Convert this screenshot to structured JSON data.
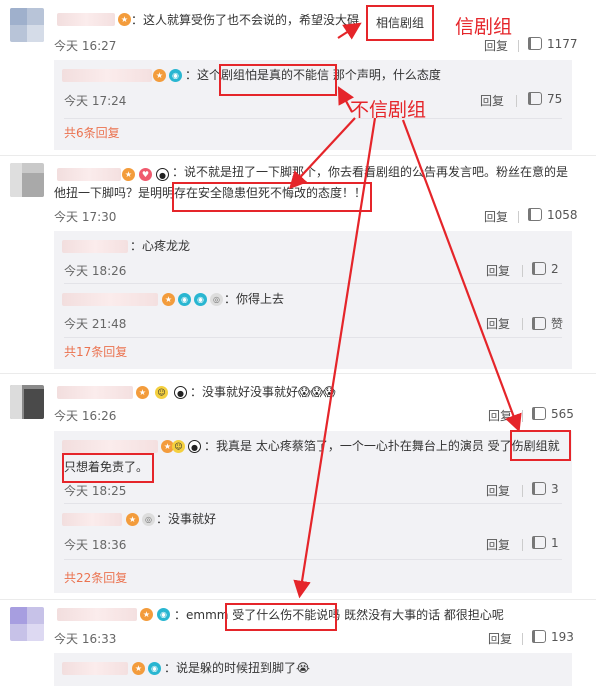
{
  "comments": [
    {
      "text": "：这人就算受伤了也不会说的，希望没大碍",
      "time": "今天 16:27",
      "reply": "回复",
      "likes": "1177",
      "sub_replies": [
        {
          "text": "：这个剧组怕是真的不能信 那个声明，什么态度",
          "time": "今天 17:24",
          "reply": "回复",
          "likes": "75"
        }
      ],
      "more": "共6条回复"
    },
    {
      "text_line1": "：说不就是扭了一下脚那个，你去看看剧组的公告再发言吧。粉丝在意的是",
      "text_line2": "他扭一下脚吗？是明明存在安全隐患但死不悔改的态度！！",
      "time": "今天 17:30",
      "reply": "回复",
      "likes": "1058",
      "sub_replies": [
        {
          "text": "：心疼龙龙",
          "time": "今天 18:26",
          "reply": "回复",
          "likes": "2"
        },
        {
          "text": "：你得上去",
          "time": "今天 21:48",
          "reply": "回复",
          "likes": "赞"
        }
      ],
      "more": "共17条回复"
    },
    {
      "text": "：没事就好没事就好😱😱😱",
      "time": "今天 16:26",
      "reply": "回复",
      "likes": "565",
      "sub_replies": [
        {
          "text_line1": "：我真是 太心疼蔡箔了，一个一心扑在舞台上的演员 受了伤剧组就",
          "text_line2": "只想着免责了。",
          "time": "今天 18:25",
          "reply": "回复",
          "likes": "3"
        },
        {
          "text": "：没事就好",
          "time": "今天 18:36",
          "reply": "回复",
          "likes": "1"
        }
      ],
      "more": "共22条回复"
    },
    {
      "text": "：emmm 受了什么伤不能说吗 既然没有大事的话 都很担心呢",
      "time": "今天 16:33",
      "reply": "回复",
      "likes": "193",
      "sub_replies": [
        {
          "text": "：说是躲的时候扭到脚了😭"
        }
      ]
    }
  ],
  "annotations": {
    "believe_box": "相信剧组",
    "believe_label": "信剧组",
    "disbelieve_label": "不信剧组"
  },
  "colors": {
    "highlight": "#e5252a",
    "link": "#eb7350",
    "sub_bg": "#f2f2f5"
  },
  "icons": [
    "fire-badge-icon",
    "vip-badge-icon",
    "face-badge-icon",
    "panda-badge-icon",
    "medal-badge-icon",
    "thumbs-up-icon"
  ]
}
